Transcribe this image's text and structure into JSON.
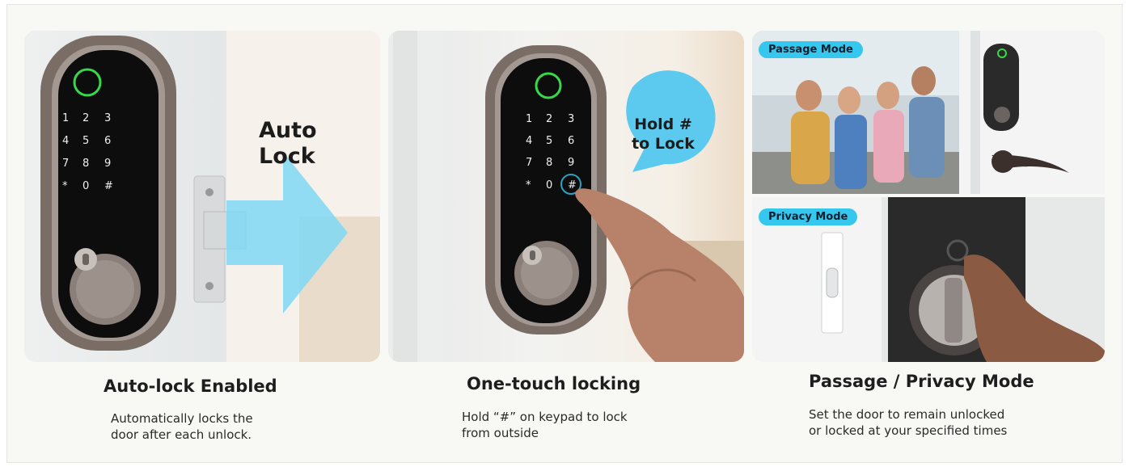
{
  "panels": [
    {
      "overlay_lines": [
        "Auto",
        "Lock"
      ],
      "title": "Auto-lock Enabled",
      "desc_lines": [
        "Automatically locks the",
        "door after each unlock."
      ]
    },
    {
      "overlay_lines": [
        "Hold #",
        "to Lock"
      ],
      "title": "One-touch locking",
      "desc_lines": [
        "Hold “#” on keypad to lock",
        "from outside"
      ]
    },
    {
      "badges": [
        "Passage Mode",
        "Privacy Mode"
      ],
      "title": "Passage / Privacy Mode",
      "desc_lines": [
        "Set the door to remain unlocked",
        "or locked at your specified times"
      ]
    }
  ],
  "keypad": [
    "1",
    "2",
    "3",
    "4",
    "5",
    "6",
    "7",
    "8",
    "9",
    "*",
    "0",
    "#"
  ],
  "colors": {
    "accent": "#35c7ee",
    "lock_body": "#7a6d66",
    "keypad_bg": "#111111",
    "fingerprint": "#37d84a"
  }
}
